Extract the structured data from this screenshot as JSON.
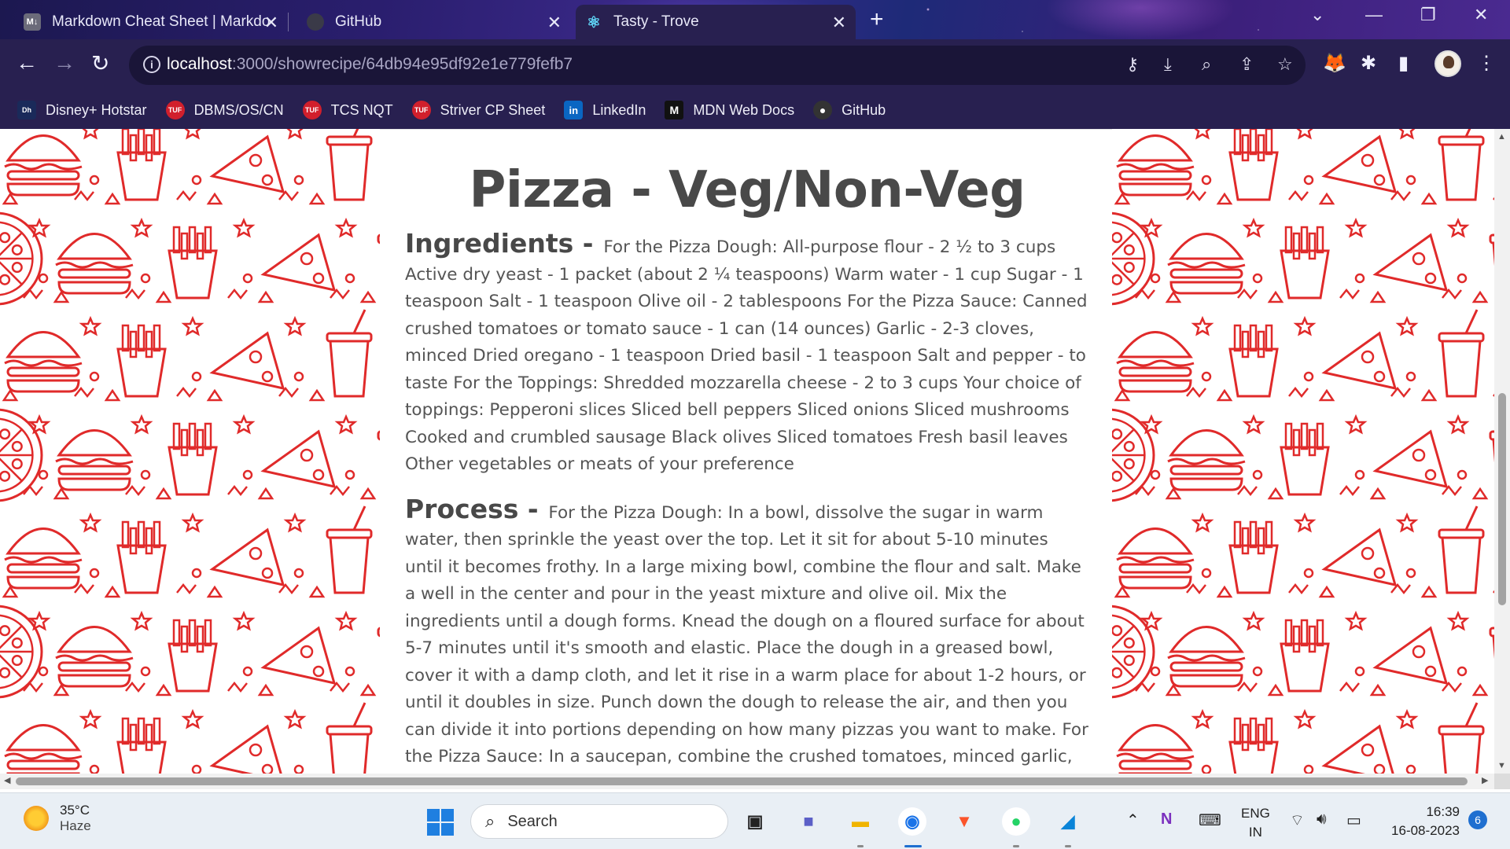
{
  "browser": {
    "tabs": [
      {
        "label": "Markdown Cheat Sheet | Markdo",
        "favicon": "M↓",
        "active": false
      },
      {
        "label": "GitHub",
        "favicon": "github-icon",
        "active": false
      },
      {
        "label": "Tasty - Trove",
        "favicon": "react-icon",
        "active": true
      }
    ],
    "new_tab": "+",
    "address": {
      "host": "localhost",
      "path": ":3000/showrecipe/64db94e95df92e1e779fefb7"
    },
    "bookmarks": [
      {
        "label": "Disney+ Hotstar",
        "icon": "Dh",
        "color": "#1a2a5a"
      },
      {
        "label": "DBMS/OS/CN",
        "icon": "TUF",
        "color": "#d11f2c"
      },
      {
        "label": "TCS NQT",
        "icon": "TUF",
        "color": "#d11f2c"
      },
      {
        "label": "Striver CP Sheet",
        "icon": "TUF",
        "color": "#d11f2c"
      },
      {
        "label": "LinkedIn",
        "icon": "in",
        "color": "#0a66c2"
      },
      {
        "label": "MDN Web Docs",
        "icon": "M",
        "color": "#111111"
      },
      {
        "label": "GitHub",
        "icon": "●",
        "color": "#333333"
      }
    ]
  },
  "recipe": {
    "title": "Pizza - Veg/Non-Veg",
    "ingredients_heading": "Ingredients -",
    "ingredients_text": "For the Pizza Dough: All-purpose flour - 2 ½ to 3 cups Active dry yeast - 1 packet (about 2 ¼ teaspoons) Warm water - 1 cup Sugar - 1 teaspoon Salt - 1 teaspoon Olive oil - 2 tablespoons For the Pizza Sauce: Canned crushed tomatoes or tomato sauce - 1 can (14 ounces) Garlic - 2-3 cloves, minced Dried oregano - 1 teaspoon Dried basil - 1 teaspoon Salt and pepper - to taste For the Toppings: Shredded mozzarella cheese - 2 to 3 cups Your choice of toppings: Pepperoni slices Sliced bell peppers Sliced onions Sliced mushrooms Cooked and crumbled sausage Black olives Sliced tomatoes Fresh basil leaves Other vegetables or meats of your preference",
    "process_heading": "Process -",
    "process_text": "For the Pizza Dough: In a bowl, dissolve the sugar in warm water, then sprinkle the yeast over the top. Let it sit for about 5-10 minutes until it becomes frothy. In a large mixing bowl, combine the flour and salt. Make a well in the center and pour in the yeast mixture and olive oil. Mix the ingredients until a dough forms. Knead the dough on a floured surface for about 5-7 minutes until it's smooth and elastic. Place the dough in a greased bowl, cover it with a damp cloth, and let it rise in a warm place for about 1-2 hours, or until it doubles in size. Punch down the dough to release the air, and then you can divide it into portions depending on how many pizzas you want to make. For the Pizza Sauce: In a saucepan, combine the crushed tomatoes, minced garlic,"
  },
  "taskbar": {
    "weather": {
      "temp": "35°C",
      "condition": "Haze"
    },
    "search_label": "Search",
    "language": {
      "line1": "ENG",
      "line2": "IN"
    },
    "clock": {
      "time": "16:39",
      "date": "16-08-2023"
    },
    "notification_count": "6"
  },
  "colors": {
    "pattern_stroke": "#e02a2a",
    "chrome_bg": "#282050",
    "accent": "#1f7fe0"
  }
}
